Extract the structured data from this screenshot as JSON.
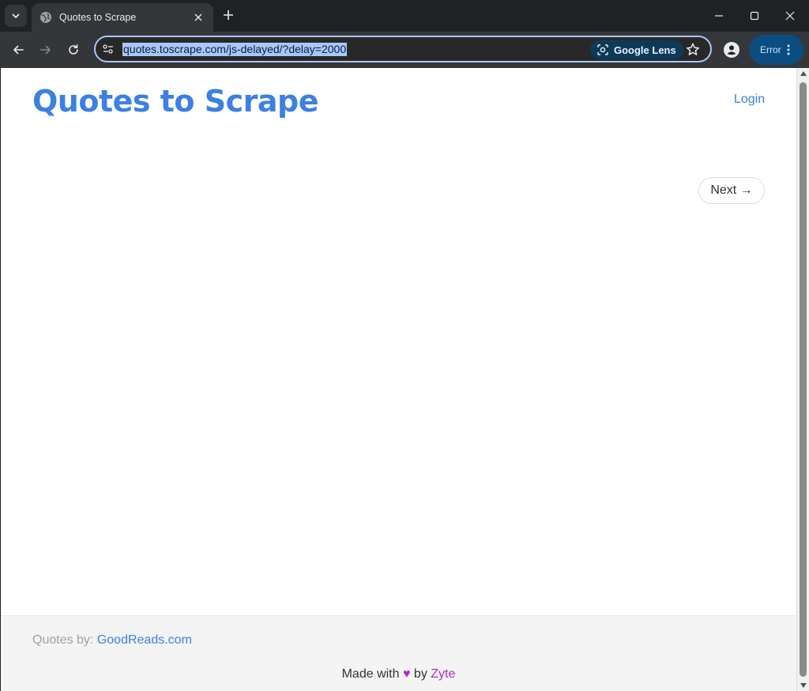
{
  "browser": {
    "tab": {
      "title": "Quotes to Scrape",
      "favicon": "globe-icon"
    },
    "address": {
      "url": "quotes.toscrape.com/js-delayed/?delay=2000"
    },
    "lens_label": "Google Lens",
    "error_label": "Error",
    "accent": "#a8c7fa"
  },
  "page": {
    "site_title": "Quotes to Scrape",
    "login_label": "Login",
    "next_label": "Next →",
    "footer": {
      "credit_prefix": "Quotes by:",
      "credit_link": "GoodReads.com",
      "made_with": "Made with",
      "heart": "♥",
      "by": "by",
      "brand": "Zyte"
    },
    "colors": {
      "link": "#3c80e4",
      "brand": "#b129c9"
    }
  }
}
